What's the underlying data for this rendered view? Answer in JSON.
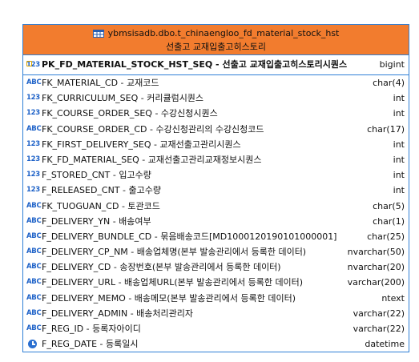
{
  "table": {
    "title": "ybmsisadb.dbo.t_chinaengloo_fd_material_stock_hst",
    "comment": "선출고 교재입출고히스토리"
  },
  "columns": [
    {
      "icon": "123",
      "label": "PK_FD_MATERIAL_STOCK_HST_SEQ - 선출고 교재입출고히스토리시퀀스",
      "type": "bigint",
      "pk": true
    },
    {
      "icon": "ABC",
      "label": "FK_MATERIAL_CD - 교재코드",
      "type": "char(4)"
    },
    {
      "icon": "123",
      "label": "FK_CURRICULUM_SEQ - 커리큘럼시퀀스",
      "type": "int"
    },
    {
      "icon": "123",
      "label": "FK_COURSE_ORDER_SEQ - 수강신청시퀀스",
      "type": "int"
    },
    {
      "icon": "ABC",
      "label": "FK_COURSE_ORDER_CD - 수강신청관리의 수강신청코드",
      "type": "char(17)"
    },
    {
      "icon": "123",
      "label": "FK_FIRST_DELIVERY_SEQ - 교재선출고관리시퀀스",
      "type": "int"
    },
    {
      "icon": "123",
      "label": "FK_FD_MATERIAL_SEQ - 교재선출고관리교재정보시퀀스",
      "type": "int"
    },
    {
      "icon": "123",
      "label": "F_STORED_CNT - 입고수량",
      "type": "int"
    },
    {
      "icon": "123",
      "label": "F_RELEASED_CNT - 출고수량",
      "type": "int"
    },
    {
      "icon": "ABC",
      "label": "FK_TUOGUAN_CD - 토관코드",
      "type": "char(5)"
    },
    {
      "icon": "ABC",
      "label": "F_DELIVERY_YN - 배송여부",
      "type": "char(1)"
    },
    {
      "icon": "ABC",
      "label": "F_DELIVERY_BUNDLE_CD - 묶음배송코드[MD100012019010100000​1]",
      "type": "char(25)"
    },
    {
      "icon": "ABC",
      "label": "F_DELIVERY_CP_NM - 배송업체명(본부 발송관리에서 등록한 데이터)",
      "type": "nvarchar(50)"
    },
    {
      "icon": "ABC",
      "label": "F_DELIVERY_CD - 송장번호(본부 발송관리에서 등록한 데이터)",
      "type": "nvarchar(20)"
    },
    {
      "icon": "ABC",
      "label": "F_DELIVERY_URL - 배송업체URL(본부 발송관리에서 등록한 데이터)",
      "type": "varchar(200)"
    },
    {
      "icon": "ABC",
      "label": "F_DELIVERY_MEMO - 배송메모(본부 발송관리에서 등록한 데이터)",
      "type": "ntext"
    },
    {
      "icon": "ABC",
      "label": "F_DELIVERY_ADMIN - 배송처리관리자",
      "type": "varchar(22)"
    },
    {
      "icon": "ABC",
      "label": "F_REG_ID - 등록자아이디",
      "type": "varchar(22)"
    },
    {
      "icon": "clock",
      "label": "F_REG_DATE - 등록일시",
      "type": "datetime"
    }
  ]
}
